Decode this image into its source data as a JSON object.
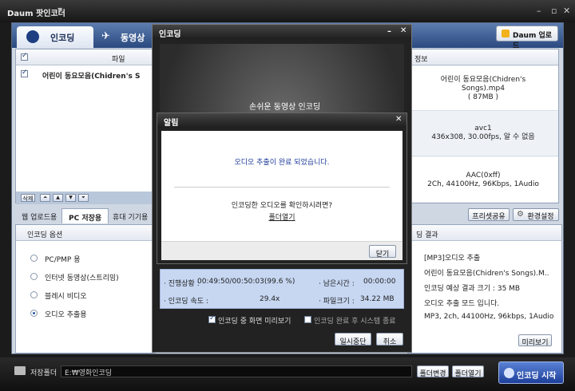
{
  "app": {
    "title": "Daum 팟인코더"
  },
  "tabs": {
    "encoding": "인코딩",
    "video": "동영상"
  },
  "header": {
    "daum_upload": "Daum 업로드"
  },
  "filelist": {
    "col_file": "파일",
    "file_name": "어린이 동요모음(Chidren's S"
  },
  "info": {
    "col_header": "정보",
    "file_line1": "어린이 동요모음(Chidren's",
    "file_line2": "Songs).mp4",
    "file_line3": "( 87MB )",
    "video_line1": "avc1",
    "video_line2": "436x308, 30.00fps, 알 수 없음",
    "audio_line1": "AAC(0xff)",
    "audio_line2": "2Ch, 44100Hz, 96Kbps, 1Audio"
  },
  "list_controls": {
    "delete": "삭제"
  },
  "subtabs": {
    "web": "웹 업로드용",
    "pc": "PC 저장용",
    "portable": "휴대 기기용"
  },
  "actions": {
    "preset_share": "프리셋공유",
    "settings": "환경설정"
  },
  "options": {
    "title": "인코딩 옵션",
    "items": [
      "PC/PMP 용",
      "인터넷 동영상(스트리밍)",
      "블레시 비디오",
      "오디오 추출용"
    ],
    "selected": 3
  },
  "result": {
    "title": "딩 결과",
    "lines": [
      "[MP3]오디오 추출",
      "어린이 동요모음(Chidren's Songs).M..",
      "인코딩 예상 결과 크기 : 35 MB",
      "오디오 추출 모드 입니다.",
      "MP3, 2ch, 44100Hz, 96kbps, 1Audio"
    ],
    "preview": "미리보기"
  },
  "bottom": {
    "folder_label": "저장폴더",
    "folder_path": "E:₩영화인코딩",
    "change_folder": "폴더변경",
    "open_folder": "폴더열기",
    "start": "인코딩 시작"
  },
  "enc_dialog": {
    "title": "인코딩",
    "slogan": "손쉬운 동영상 인코딩",
    "status_label": "· 진행상황 :",
    "status_value": "00:49:50/00:50:03(99.6 %)",
    "remaining_label": "· 남은시간 :",
    "remaining_value": "00:00:00",
    "speed_label": "· 인코딩 속도 :",
    "speed_value": "29.4x",
    "filesize_label": "· 파일크기 :",
    "filesize_value": "34.22 MB",
    "opt_preview": "인코딩 중 화면 미리보기",
    "opt_shutdown": "인코딩 완료 후 시스템 종료",
    "pause": "일시중단",
    "cancel": "취소"
  },
  "alert": {
    "title": "알림",
    "message": "오디오 추출이 완료 되었습니다.",
    "question": "인코딩한 오디오를 확인하시려면?",
    "open_folder": "폴더열기",
    "close": "닫기"
  }
}
